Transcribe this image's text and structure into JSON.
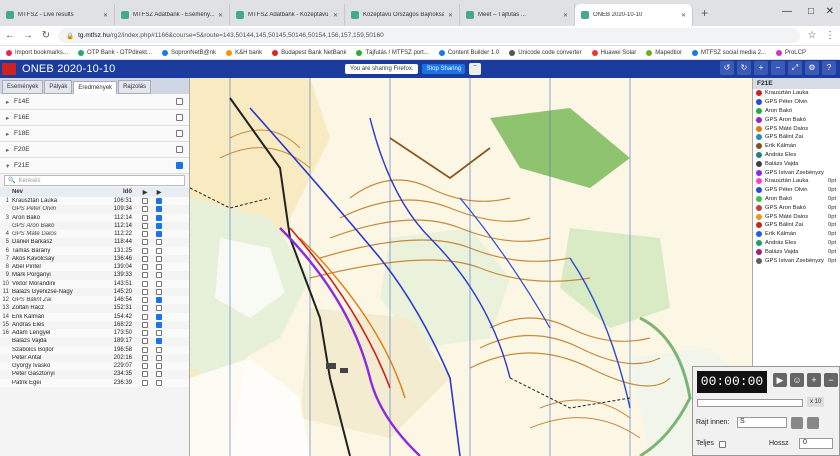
{
  "browser": {
    "tabs": [
      {
        "label": "MTFSZ - Live results",
        "active": false
      },
      {
        "label": "MTFSZ Adatbank - Esemény...",
        "active": false
      },
      {
        "label": "MTFSZ Adatbank - Középtávú O...",
        "active": false
      },
      {
        "label": "Középtávú Országos Bajnokság 2020 ...",
        "active": false
      },
      {
        "label": "Meet – Tájfutás ...",
        "active": false
      },
      {
        "label": "ONEB 2020-10-10",
        "active": true
      }
    ],
    "new_tab": "+",
    "url_domain": "tg.mtfsz.hu",
    "url_path": "/rg2/index.php#1166&course=5&route=143,50144,145,50145,50146,50154,156,157,159,50160",
    "bookmarks": [
      "Import bookmarks...",
      "OTP Bank - OTPdirekt...",
      "SopronNetB@nk",
      "K&H bank",
      "Budapest Bank NetBank",
      "Tájfutás / MTFSZ port...",
      "Content Builder 1.0",
      "Unicode code converter",
      "Huawei Solar",
      "Mapedtior",
      "MTFSZ social media 2...",
      "ProLCP"
    ]
  },
  "app": {
    "title": "ONEB 2020-10-10",
    "sharing_text": "You are sharing Firefox.",
    "stop_sharing": "Stop Sharing",
    "minimize": "–",
    "colors": {
      "appbar": "#1b3c9c",
      "accent": "#1a73e8"
    }
  },
  "left": {
    "tabs": [
      "Események",
      "Pályák",
      "Eredmények",
      "Rajzolás"
    ],
    "active_tab": "Eredmények",
    "categories": [
      {
        "label": "F14E",
        "open": false,
        "checked": false
      },
      {
        "label": "F16E",
        "open": false,
        "checked": false
      },
      {
        "label": "F18E",
        "open": false,
        "checked": false
      },
      {
        "label": "F20E",
        "open": false,
        "checked": false
      },
      {
        "label": "F21E",
        "open": true,
        "checked": true
      }
    ],
    "search_placeholder": "Keresés",
    "col_name": "Név",
    "col_time": "Idő",
    "results": [
      {
        "pos": "1",
        "name": "Krausztán Lauka",
        "time": "106:31",
        "gps": false,
        "c1": false,
        "c2": true
      },
      {
        "pos": "",
        "name": "GPS Péter Olvin",
        "time": "109:34",
        "gps": true,
        "c1": false,
        "c2": true
      },
      {
        "pos": "3",
        "name": "Áron Bakó",
        "time": "112:14",
        "gps": false,
        "c1": false,
        "c2": true
      },
      {
        "pos": "",
        "name": "GPS Áron Bakó",
        "time": "112:14",
        "gps": true,
        "c1": false,
        "c2": true
      },
      {
        "pos": "4",
        "name": "GPS Máté Dalos",
        "time": "112:22",
        "gps": true,
        "c1": false,
        "c2": true
      },
      {
        "pos": "5",
        "name": "Dániel Barkász",
        "time": "118:44",
        "gps": false,
        "c1": false,
        "c2": false
      },
      {
        "pos": "6",
        "name": "Tamás Bárány",
        "time": "131:25",
        "gps": false,
        "c1": false,
        "c2": false
      },
      {
        "pos": "7",
        "name": "Ákos Kavolcsay",
        "time": "136:46",
        "gps": false,
        "c1": false,
        "c2": false
      },
      {
        "pos": "8",
        "name": "Ábel Pintér",
        "time": "139:04",
        "gps": false,
        "c1": false,
        "c2": false
      },
      {
        "pos": "9",
        "name": "Márk Porgányi",
        "time": "139:33",
        "gps": false,
        "c1": false,
        "c2": false
      },
      {
        "pos": "10",
        "name": "Viktor Morandini",
        "time": "143:51",
        "gps": false,
        "c1": false,
        "c2": false
      },
      {
        "pos": "11",
        "name": "Balázs Gyenizse-Nagy",
        "time": "145:20",
        "gps": false,
        "c1": false,
        "c2": false
      },
      {
        "pos": "12",
        "name": "GPS Bálint Zai",
        "time": "146:54",
        "gps": true,
        "c1": false,
        "c2": true
      },
      {
        "pos": "13",
        "name": "Zoltán Rácz",
        "time": "152:31",
        "gps": false,
        "c1": false,
        "c2": false
      },
      {
        "pos": "14",
        "name": "Erik Kálmán",
        "time": "154:42",
        "gps": false,
        "c1": false,
        "c2": true
      },
      {
        "pos": "15",
        "name": "András Éles",
        "time": "168:22",
        "gps": false,
        "c1": false,
        "c2": true
      },
      {
        "pos": "16",
        "name": "Ádám Lengyel",
        "time": "173:50",
        "gps": false,
        "c1": false,
        "c2": false
      },
      {
        "pos": "",
        "name": "Balázs Vajda",
        "time": "189:17",
        "gps": false,
        "c1": false,
        "c2": true
      },
      {
        "pos": "",
        "name": "Szabolcs Bojtor",
        "time": "196:58",
        "gps": false,
        "c1": false,
        "c2": false
      },
      {
        "pos": "",
        "name": "Péter Antal",
        "time": "202:16",
        "gps": false,
        "c1": false,
        "c2": false
      },
      {
        "pos": "",
        "name": "György Ivaskó",
        "time": "229:07",
        "gps": false,
        "c1": false,
        "c2": false
      },
      {
        "pos": "",
        "name": "Péter Gasztonyi",
        "time": "234:35",
        "gps": false,
        "c1": false,
        "c2": false
      },
      {
        "pos": "",
        "name": "Patrik Egei",
        "time": "236:39",
        "gps": false,
        "c1": false,
        "c2": false
      }
    ]
  },
  "right": {
    "title": "F21E",
    "runners": [
      {
        "name": "Krausztán Lauka",
        "color": "#cc2222",
        "pts": ""
      },
      {
        "name": "GPS Péter Olvin",
        "color": "#2a4ad0",
        "pts": ""
      },
      {
        "name": "Áron Bakó",
        "color": "#22aa44",
        "pts": ""
      },
      {
        "name": "GPS Áron Bakó",
        "color": "#a020c0",
        "pts": ""
      },
      {
        "name": "GPS Máté Dalos",
        "color": "#e07a10",
        "pts": ""
      },
      {
        "name": "GPS Bálint Zai",
        "color": "#2090c0",
        "pts": ""
      },
      {
        "name": "Erik Kálmán",
        "color": "#805020",
        "pts": ""
      },
      {
        "name": "András Éles",
        "color": "#208080",
        "pts": ""
      },
      {
        "name": "Balázs Vajda",
        "color": "#404040",
        "pts": ""
      },
      {
        "name": "GPS Istvan Zsebényzy",
        "color": "#8a2be2",
        "pts": ""
      },
      {
        "name": "Krausztán Lauka",
        "color": "#ff40c0",
        "pts": "0pt"
      },
      {
        "name": "GPS Péter Olvin",
        "color": "#2a4ad0",
        "pts": "0pt"
      },
      {
        "name": "Áron Bakó",
        "color": "#40c040",
        "pts": "0pt"
      },
      {
        "name": "GPS Áron Bakó",
        "color": "#c04040",
        "pts": "0pt"
      },
      {
        "name": "GPS Máté Dalos",
        "color": "#e0a010",
        "pts": "0pt"
      },
      {
        "name": "GPS Bálint Zai",
        "color": "#cc2222",
        "pts": "0pt"
      },
      {
        "name": "Erik Kálmán",
        "color": "#2060e0",
        "pts": "0pt"
      },
      {
        "name": "András Éles",
        "color": "#20a060",
        "pts": "0pt"
      },
      {
        "name": "Balázs Vajda",
        "color": "#a02080",
        "pts": "0pt"
      },
      {
        "name": "GPS Istvan Zsebényzy",
        "color": "#606060",
        "pts": "0pt"
      }
    ]
  },
  "player": {
    "clock": "00:00:00",
    "speed": "x 10",
    "start_label": "Rajt innen:",
    "start_value": "S",
    "full_label": "Teljes",
    "length_label": "Hossz",
    "length_value": "0"
  }
}
